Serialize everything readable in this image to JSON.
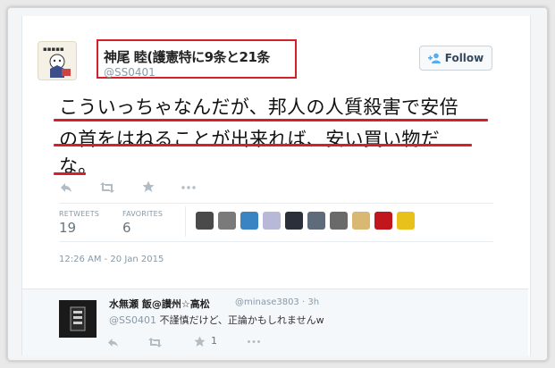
{
  "tweet": {
    "author_name": "神尾 睦(護憲特に9条と21条",
    "author_handle": "@SS0401",
    "follow_label": "Follow",
    "text_lines": [
      "こういっちゃなんだが、邦人の人質殺害で安倍",
      "の首をはねることが出来れば、安い買い物だ",
      "な。"
    ],
    "stats": {
      "retweets_label": "RETWEETS",
      "retweets_value": "19",
      "favorites_label": "FAVORITES",
      "favorites_value": "6"
    },
    "timestamp": "12:26 AM - 20 Jan 2015",
    "actions": [
      "reply-icon",
      "retweet-icon",
      "favorite-icon",
      "more-icon"
    ]
  },
  "favoriters": [
    {
      "color": "#4a4a4a"
    },
    {
      "color": "#7a7a7a"
    },
    {
      "color": "#3a84c4"
    },
    {
      "color": "#b8b8d8"
    },
    {
      "color": "#2b2f3a"
    },
    {
      "color": "#5d6b7a"
    },
    {
      "color": "#6a6a6a"
    },
    {
      "color": "#d9b873"
    },
    {
      "color": "#c0161c"
    },
    {
      "color": "#e8c21a"
    }
  ],
  "reply": {
    "author_name": "水無瀬 飯@讃州☆高松",
    "author_handle": "@minase3803 · 3h",
    "mention": "@SS0401",
    "text": "不謹慎だけど、正論かもしれませんw",
    "favorite_count": "1"
  },
  "colors": {
    "highlight_red": "#d5202b",
    "link_gray": "#8899a6"
  }
}
